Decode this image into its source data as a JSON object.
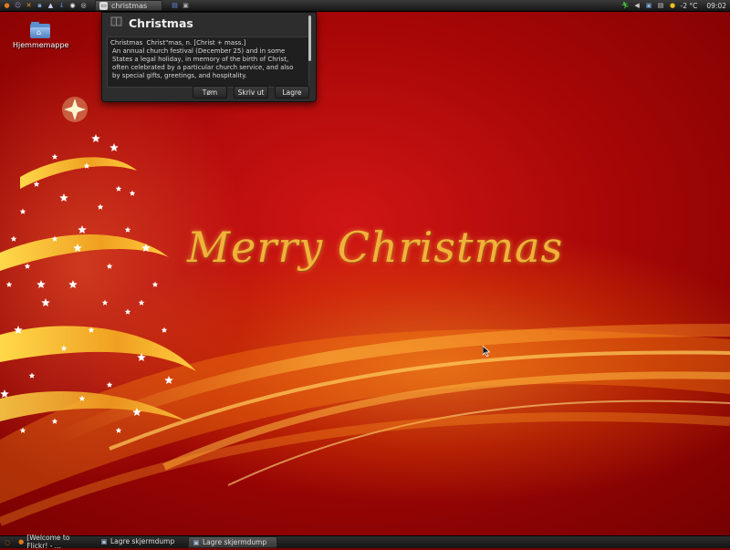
{
  "top_panel": {
    "launchers": [
      {
        "icon": "firefox-icon",
        "glyph": "●",
        "color": "#e07a20"
      },
      {
        "icon": "user-icon",
        "glyph": "☺",
        "color": "#9b8cd0"
      },
      {
        "icon": "tools-icon",
        "glyph": "✕",
        "color": "#e0a020"
      },
      {
        "icon": "terminal-icon",
        "glyph": "▪",
        "color": "#7aa0d0"
      },
      {
        "icon": "mail-icon",
        "glyph": "▲",
        "color": "#d0d0ff"
      },
      {
        "icon": "download-icon",
        "glyph": "↓",
        "color": "#5f8fe0"
      },
      {
        "icon": "disc-icon",
        "glyph": "◉",
        "color": "#eeeeee"
      },
      {
        "icon": "chrome-icon",
        "glyph": "◎",
        "color": "#e0e0e0"
      }
    ],
    "active_task": {
      "label": "christmas"
    },
    "small_icons": [
      {
        "icon": "notes-icon",
        "glyph": "▤",
        "color": "#5f8fe0"
      },
      {
        "icon": "applet-icon",
        "glyph": "▣",
        "color": "#b0b0b0"
      }
    ],
    "tray": {
      "temperature": "-2 °C",
      "clock": "09:02"
    }
  },
  "desktop": {
    "home_folder_label": "Hjemmemappe",
    "greeting": "Merry Christmas"
  },
  "dictionary": {
    "title": "Christmas",
    "headword": "Christmas",
    "pronunciation": "Christ\"mas, n. [Christ + mass.]",
    "definition": "An annual church festival (December 25) and in some States a legal holiday, in memory of the birth of Christ, often celebrated by a particular church service, and also by special gifts, greetings, and hospitality.",
    "buttons": {
      "clear": "Tøm",
      "print": "Skriv ut",
      "save": "Lagre"
    }
  },
  "bottom_panel": {
    "tasks": [
      {
        "label": "[Welcome to Flickr! - ...",
        "icon": "firefox-icon",
        "active": false
      },
      {
        "label": "Lagre skjermdump",
        "icon": "camera-icon",
        "active": false
      },
      {
        "label": "Lagre skjermdump",
        "icon": "camera-icon",
        "active": true
      }
    ]
  }
}
